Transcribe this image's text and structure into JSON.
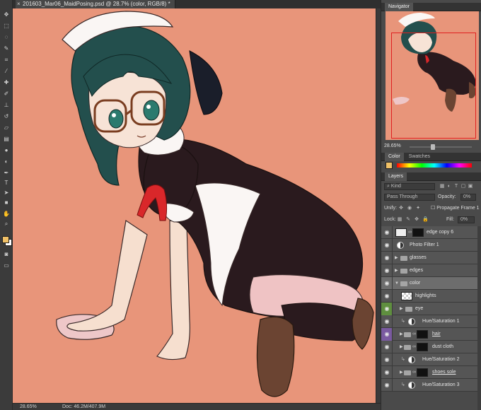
{
  "document": {
    "tab_title": "201603_Mar06_MaidPosing.psd @ 28.7% (color, RGB/8) *",
    "close_glyph": "×"
  },
  "toolbar": {
    "tools": [
      "move-tool",
      "marquee-tool",
      "lasso-tool",
      "quick-select-tool",
      "crop-tool",
      "eyedropper-tool",
      "healing-tool",
      "brush-tool",
      "clone-stamp-tool",
      "history-brush-tool",
      "eraser-tool",
      "gradient-tool",
      "blur-tool",
      "dodge-tool",
      "pen-tool",
      "type-tool",
      "path-select-tool",
      "shape-tool",
      "hand-tool",
      "zoom-tool"
    ],
    "foreground_color": "#f0c066",
    "background_color": "#ffffff"
  },
  "status": {
    "zoom": "28.65%",
    "doc": "Doc: 46.2M/407.9M"
  },
  "navigator": {
    "title": "Navigator",
    "zoom": "28.65%"
  },
  "color_panel": {
    "tab_color": "Color",
    "tab_swatches": "Swatches"
  },
  "layers_panel": {
    "title": "Layers",
    "kind_label": "Kind",
    "blend_mode": "Pass Through",
    "opacity_label": "Opacity:",
    "opacity_value": "0%",
    "unify_label": "Unify:",
    "propagate_label": "Propagate Frame 1",
    "lock_label": "Lock:",
    "fill_label": "Fill:",
    "fill_value": "0%",
    "layers": [
      {
        "name": "edge copy 6",
        "type": "pixel",
        "visible": true
      },
      {
        "name": "Photo Filter 1",
        "type": "adjustment",
        "visible": true
      },
      {
        "name": "glasses",
        "type": "group",
        "visible": true
      },
      {
        "name": "edges",
        "type": "group",
        "visible": true
      },
      {
        "name": "color",
        "type": "group-open",
        "visible": true,
        "selected": true
      },
      {
        "name": "highlights",
        "type": "pixel",
        "visible": true
      },
      {
        "name": "eye",
        "type": "group",
        "visible": true
      },
      {
        "name": "Hue/Saturation 1",
        "type": "adjustment",
        "visible": true
      },
      {
        "name": "hair",
        "type": "group-mask",
        "visible": true
      },
      {
        "name": "dust cloth",
        "type": "group-mask",
        "visible": true
      },
      {
        "name": "Hue/Saturation 2",
        "type": "adjustment",
        "visible": true
      },
      {
        "name": "shoes sole",
        "type": "group-mask",
        "visible": true
      },
      {
        "name": "Hue/Saturation 3",
        "type": "adjustment",
        "visible": true
      }
    ]
  },
  "colors": {
    "canvas_bg": "#e8957a",
    "eye_color_tag": "#5f8f3f",
    "hair_color_tag": "#7a5aa0",
    "nav_box": "#e02020"
  }
}
